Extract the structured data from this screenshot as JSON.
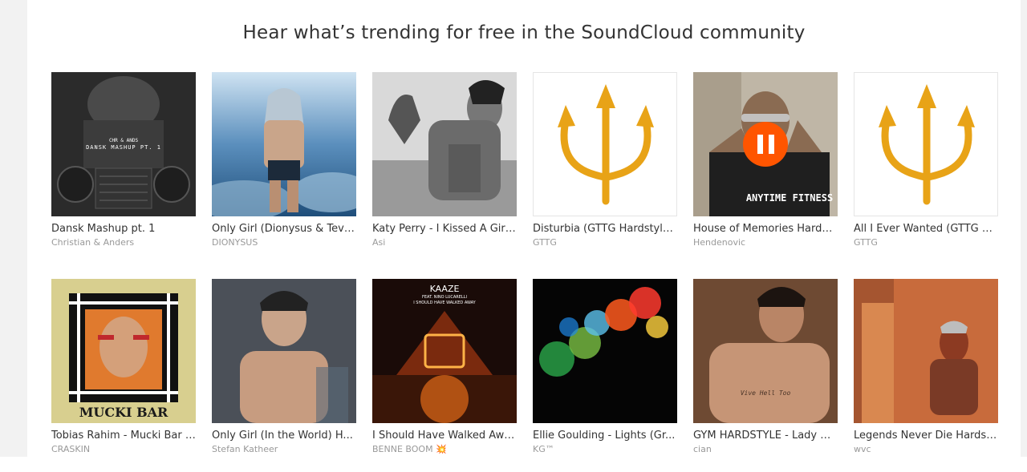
{
  "heading": "Hear what’s trending for free in the SoundCloud community",
  "tracks": [
    {
      "title": "Dansk Mashup pt. 1",
      "artist": "Christian & Anders",
      "art_text": "DANSK MASHUP PT. 1",
      "art_small": "CHR & ANDS"
    },
    {
      "title": "Only Girl (Dionysus & Tevv...",
      "artist": "DIONYSUS"
    },
    {
      "title": "Katy Perry - I Kissed A Girl ...",
      "artist": "Asi"
    },
    {
      "title": "Disturbia (GTTG Hardstyle...",
      "artist": "GTTG"
    },
    {
      "title": "House of Memories Hardst...",
      "artist": "Hendenovic",
      "playing": true,
      "shirt_text": "ANYTIME FITNESS"
    },
    {
      "title": "All I Ever Wanted (GTTG H...",
      "artist": "GTTG"
    },
    {
      "title": "Tobias Rahim - Mucki Bar (...",
      "artist": "CRASKIN",
      "art_text": "MUCKI BAR"
    },
    {
      "title": "Only Girl (In the World) H...",
      "artist": "Stefan Katheer"
    },
    {
      "title": "I Should Have Walked Awa...",
      "artist": "BENNE BOOM 💥",
      "art_text": "KAAZE",
      "art_small": "FEAT. NINO LUCARELLI",
      "art_small2": "I SHOULD HAVE WALKED AWAY"
    },
    {
      "title": "Ellie Goulding - Lights (Gr...",
      "artist": "KG™"
    },
    {
      "title": "GYM HARDSTYLE - Lady G...",
      "artist": "cian",
      "art_text": "Vive Hell Too"
    },
    {
      "title": "Legends Never Die Hardst...",
      "artist": "wvc"
    }
  ],
  "colors": {
    "accent": "#ff5500",
    "title": "#333333",
    "artist": "#999999",
    "trident": "#e8a317"
  },
  "icons": {
    "pause": "pause-icon",
    "trident": "trident-icon"
  }
}
